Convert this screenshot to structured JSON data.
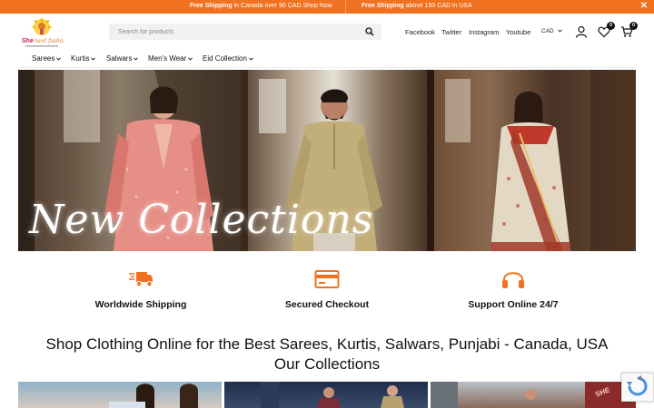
{
  "announcement": {
    "msg1_bold": "Free Shipping",
    "msg1_rest": " in Canada over 90 CAD Shop Now",
    "msg2_bold": "Free Shipping",
    "msg2_rest": " above 150 CAD in USA",
    "close_icon": "close-icon",
    "bg_color": "#f0711f"
  },
  "header": {
    "logo_text": "She next fashion",
    "search": {
      "placeholder": "Search for products",
      "value": "",
      "icon": "search-icon"
    },
    "social": [
      "Facebook",
      "Twitter",
      "Instagram",
      "Youtube"
    ],
    "currency": "CAD",
    "wishlist_count": "0",
    "cart_count": "0",
    "icons": [
      "user-icon",
      "heart-icon",
      "cart-icon"
    ]
  },
  "nav": {
    "items": [
      "Sarees",
      "Kurtis",
      "Salwars",
      "Men's Wear",
      "Eid Collection"
    ]
  },
  "hero": {
    "text": "New Collections"
  },
  "features": [
    {
      "label": "Worldwide Shipping",
      "icon": "truck-icon"
    },
    {
      "label": "Secured Checkout",
      "icon": "credit-card-icon"
    },
    {
      "label": "Support Online 24/7",
      "icon": "headphones-icon"
    }
  ],
  "headings": {
    "main": "Shop Clothing Online for the Best Sarees, Kurtis, Salwars, Punjabi - Canada, USA",
    "collections": "Our Collections"
  },
  "colors": {
    "accent": "#f0711f",
    "text": "#111111"
  }
}
